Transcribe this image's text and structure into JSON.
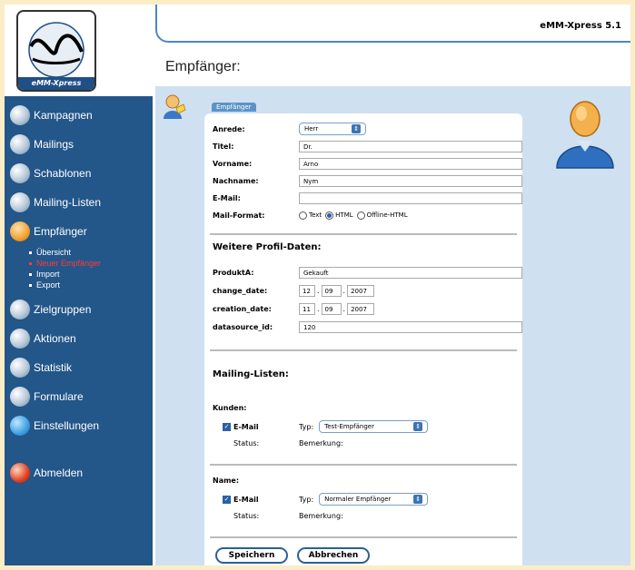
{
  "app": {
    "title": "eMM-Xpress 5.1",
    "logo_text": "eMM-Xpress"
  },
  "page": {
    "title": "Empfänger:"
  },
  "nav": {
    "items": [
      {
        "label": "Kampagnen",
        "icon": "kampagnen-icon"
      },
      {
        "label": "Mailings",
        "icon": "mailings-icon"
      },
      {
        "label": "Schablonen",
        "icon": "schablonen-icon"
      },
      {
        "label": "Mailing-Listen",
        "icon": "mailing-listen-icon"
      },
      {
        "label": "Empfänger",
        "icon": "empfaenger-icon"
      },
      {
        "label": "Zielgruppen",
        "icon": "zielgruppen-icon"
      },
      {
        "label": "Aktionen",
        "icon": "aktionen-icon"
      },
      {
        "label": "Statistik",
        "icon": "statistik-icon"
      },
      {
        "label": "Formulare",
        "icon": "formulare-icon"
      },
      {
        "label": "Einstellungen",
        "icon": "einstellungen-icon"
      },
      {
        "label": "Abmelden",
        "icon": "abmelden-icon"
      }
    ],
    "sub": [
      "Übersicht",
      "Neuer Empfänger",
      "Import",
      "Export"
    ]
  },
  "form": {
    "tab": "Empfänger",
    "anrede": {
      "label": "Anrede:",
      "value": "Herr"
    },
    "titel": {
      "label": "Titel:",
      "value": "Dr."
    },
    "vorname": {
      "label": "Vorname:",
      "value": "Arno"
    },
    "nachname": {
      "label": "Nachname:",
      "value": "Nym"
    },
    "email": {
      "label": "E-Mail:",
      "value": ""
    },
    "mailformat": {
      "label": "Mail-Format:",
      "options": [
        "Text",
        "HTML",
        "Offline-HTML"
      ],
      "selected": "HTML"
    },
    "profil": {
      "heading": "Weitere Profil-Daten:",
      "produkta": {
        "label": "ProduktA:",
        "value": "Gekauft"
      },
      "change_date": {
        "label": "change_date:",
        "day": "12",
        "month": "09",
        "year": "2007"
      },
      "creation_date": {
        "label": "creation_date:",
        "day": "11",
        "month": "09",
        "year": "2007"
      },
      "datasource_id": {
        "label": "datasource_id:",
        "value": "120"
      }
    },
    "listen": {
      "heading": "Mailing-Listen:",
      "groups": [
        {
          "name": "Kunden:",
          "check_label": "E-Mail",
          "status_label": "Status:",
          "typ_label": "Typ:",
          "typ_value": "Test-Empfänger",
          "bemerkung_label": "Bemerkung:"
        },
        {
          "name": "Name:",
          "check_label": "E-Mail",
          "status_label": "Status:",
          "typ_label": "Typ:",
          "typ_value": "Normaler Empfänger",
          "bemerkung_label": "Bemerkung:"
        }
      ]
    },
    "buttons": {
      "save": "Speichern",
      "cancel": "Abbrechen"
    }
  }
}
